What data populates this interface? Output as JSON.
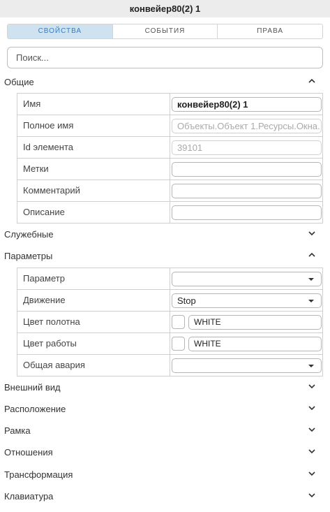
{
  "window": {
    "title": "конвейер80(2) 1"
  },
  "tabs": [
    {
      "label": "СВОЙСТВА",
      "active": true
    },
    {
      "label": "СОБЫТИЯ",
      "active": false
    },
    {
      "label": "ПРАВА",
      "active": false
    }
  ],
  "search": {
    "placeholder": "Поиск..."
  },
  "sections": {
    "general": {
      "title": "Общие",
      "expanded": true,
      "rows": [
        {
          "label": "Имя",
          "value": "конвейер80(2) 1"
        },
        {
          "label": "Полное имя",
          "value": "Объекты.Объект 1.Ресурсы.Окна."
        },
        {
          "label": "Id элемента",
          "value": "39101"
        },
        {
          "label": "Метки",
          "value": ""
        },
        {
          "label": "Комментарий",
          "value": ""
        },
        {
          "label": "Описание",
          "value": ""
        }
      ]
    },
    "service": {
      "title": "Служебные",
      "expanded": false
    },
    "params": {
      "title": "Параметры",
      "expanded": true,
      "rows": [
        {
          "label": "Параметр",
          "value": ""
        },
        {
          "label": "Движение",
          "value": "Stop"
        },
        {
          "label": "Цвет полотна",
          "value": "WHITE",
          "color": "#ffffff"
        },
        {
          "label": "Цвет работы",
          "value": "WHITE",
          "color": "#ffffff"
        },
        {
          "label": "Общая авария",
          "value": ""
        }
      ]
    },
    "appearance": {
      "title": "Внешний вид",
      "expanded": false
    },
    "location": {
      "title": "Расположение",
      "expanded": false
    },
    "frame": {
      "title": "Рамка",
      "expanded": false
    },
    "relations": {
      "title": "Отношения",
      "expanded": false
    },
    "transform": {
      "title": "Трансформация",
      "expanded": false
    },
    "keyboard": {
      "title": "Клавиатура",
      "expanded": false
    }
  },
  "colors": {
    "accent": "#3a7bbd",
    "tab_active_bg": "#cfe2ef"
  }
}
